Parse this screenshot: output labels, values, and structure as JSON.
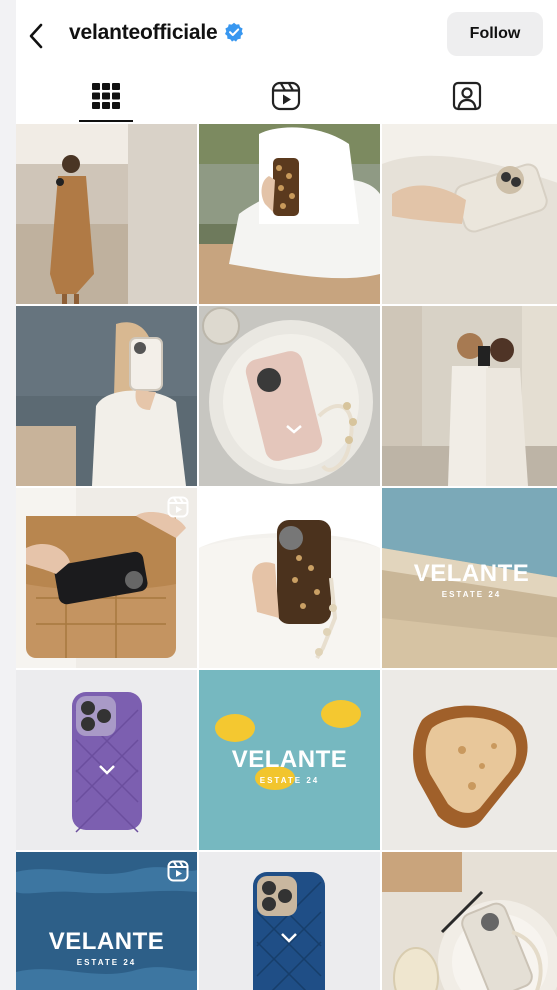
{
  "header": {
    "username": "velanteofficiale",
    "follow_label": "Follow"
  },
  "tabs": [
    {
      "name": "grid-icon",
      "active": true
    },
    {
      "name": "reels-icon",
      "active": false
    },
    {
      "name": "tagged-icon",
      "active": false
    }
  ],
  "posts": [
    {
      "type": "photo",
      "subject": "woman in tan dress mirror selfie"
    },
    {
      "type": "photo",
      "subject": "leopard phone case by water"
    },
    {
      "type": "photo",
      "subject": "hand holding cream phone case"
    },
    {
      "type": "photo",
      "subject": "woman taking mirror selfie by sea"
    },
    {
      "type": "photo",
      "subject": "pink phone case on plate"
    },
    {
      "type": "photo",
      "subject": "two women in white outfits"
    },
    {
      "type": "reel",
      "subject": "tan quilted bag with phone"
    },
    {
      "type": "reel",
      "subject": "leopard case with pearl strap"
    },
    {
      "type": "photo",
      "subject": "pool edge",
      "brand": "VELANTE",
      "sub": "ESTATE 24"
    },
    {
      "type": "photo",
      "subject": "purple quilted case"
    },
    {
      "type": "photo",
      "subject": "lemons on blue",
      "brand": "VELANTE",
      "sub": "ESTATE 24"
    },
    {
      "type": "photo",
      "subject": "toast slice"
    },
    {
      "type": "reel",
      "subject": "ocean waves",
      "brand": "VELANTE",
      "sub": "ESTATE 24"
    },
    {
      "type": "photo",
      "subject": "blue quilted case"
    },
    {
      "type": "photo",
      "subject": "phone on plate with pearls"
    }
  ],
  "colors": {
    "verified": "#3897f0",
    "follow_bg": "#eeeeef"
  }
}
